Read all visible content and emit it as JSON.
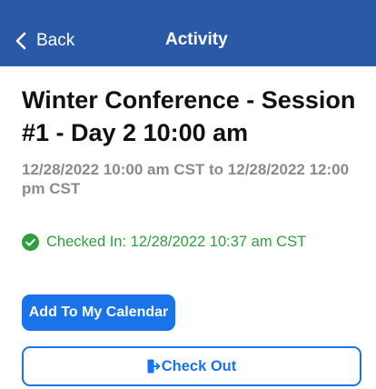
{
  "nav": {
    "back_label": "Back",
    "title": "Activity",
    "color": "#2a5aa7"
  },
  "activity": {
    "title": "Winter Conference - Session #1 - Day 2 10:00 am",
    "time_range": "12/28/2022 10:00 am CST to 12/28/2022 12:00 pm CST",
    "checkin_status": "Checked In: 12/28/2022 10:37 am CST",
    "checkin_icon": "check-circle-icon",
    "status_color": "#2f9e3e"
  },
  "actions": {
    "add_calendar_label": "Add To My Calendar",
    "check_out_label": "Check Out",
    "check_out_icon": "door-exit-icon",
    "accent_color": "#1a73e8"
  }
}
